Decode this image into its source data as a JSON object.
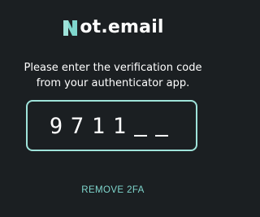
{
  "brand": {
    "name": "ot.email",
    "logo_icon": "notemail-n-logo-icon",
    "logo_color": "#7fd6cd"
  },
  "prompt": {
    "line1": "Please enter the verification code",
    "line2": "from your authenticator app."
  },
  "code_input": {
    "entered_digits": [
      "9",
      "7",
      "1",
      "1"
    ],
    "empty_slots": 2,
    "border_color": "#9fe3da"
  },
  "actions": {
    "remove_2fa_label": "REMOVE 2FA"
  },
  "colors": {
    "background": "#1b1f22",
    "accent": "#7fd6cd",
    "text": "#ffffff"
  }
}
